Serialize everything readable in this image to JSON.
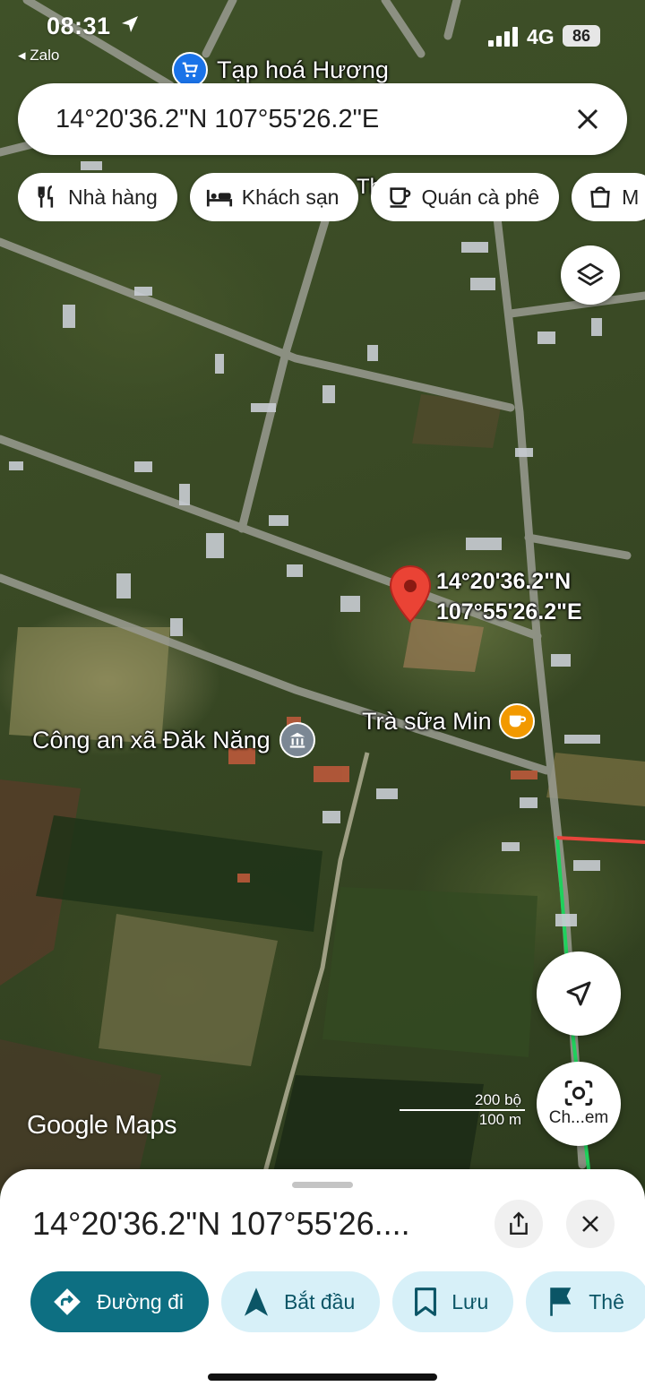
{
  "status_bar": {
    "time": "08:31",
    "back_app": "◂ Zalo",
    "network": "4G",
    "battery": "86"
  },
  "search": {
    "query": "14°20'36.2\"N 107°55'26.2\"E"
  },
  "chips": [
    {
      "label": "Nhà hàng",
      "icon": "restaurant-icon"
    },
    {
      "label": "Khách sạn",
      "icon": "hotel-icon"
    },
    {
      "label": "Quán cà phê",
      "icon": "coffee-icon"
    },
    {
      "label": "M",
      "icon": "shopping-bag-icon"
    }
  ],
  "map": {
    "top_poi": "Tạp hoá Hương",
    "pin_label_line1": "14°20'36.2\"N",
    "pin_label_line2": "107°55'26.2\"E",
    "cafe_poi": "Trà sữa Min",
    "police_poi": "Công an xã Đăk Năng",
    "partial_label": "Th",
    "logo": "Google Maps",
    "scale_top": "200 bộ",
    "scale_bottom": "100 m",
    "lens_label": "Ch...em",
    "colors": {
      "pin": "#ea4335",
      "poi_blue": "#1a73e8",
      "poi_orange": "#f29900",
      "route_green": "#1fd15c",
      "route_red": "#e8453c"
    }
  },
  "sheet": {
    "title": "14°20'36.2\"N 107°55'26....",
    "actions": [
      {
        "label": "Đường đi",
        "icon": "directions-icon"
      },
      {
        "label": "Bắt đầu",
        "icon": "navigation-arrow-icon"
      },
      {
        "label": "Lưu",
        "icon": "bookmark-icon"
      },
      {
        "label": "Thê",
        "icon": "flag-icon"
      }
    ]
  }
}
